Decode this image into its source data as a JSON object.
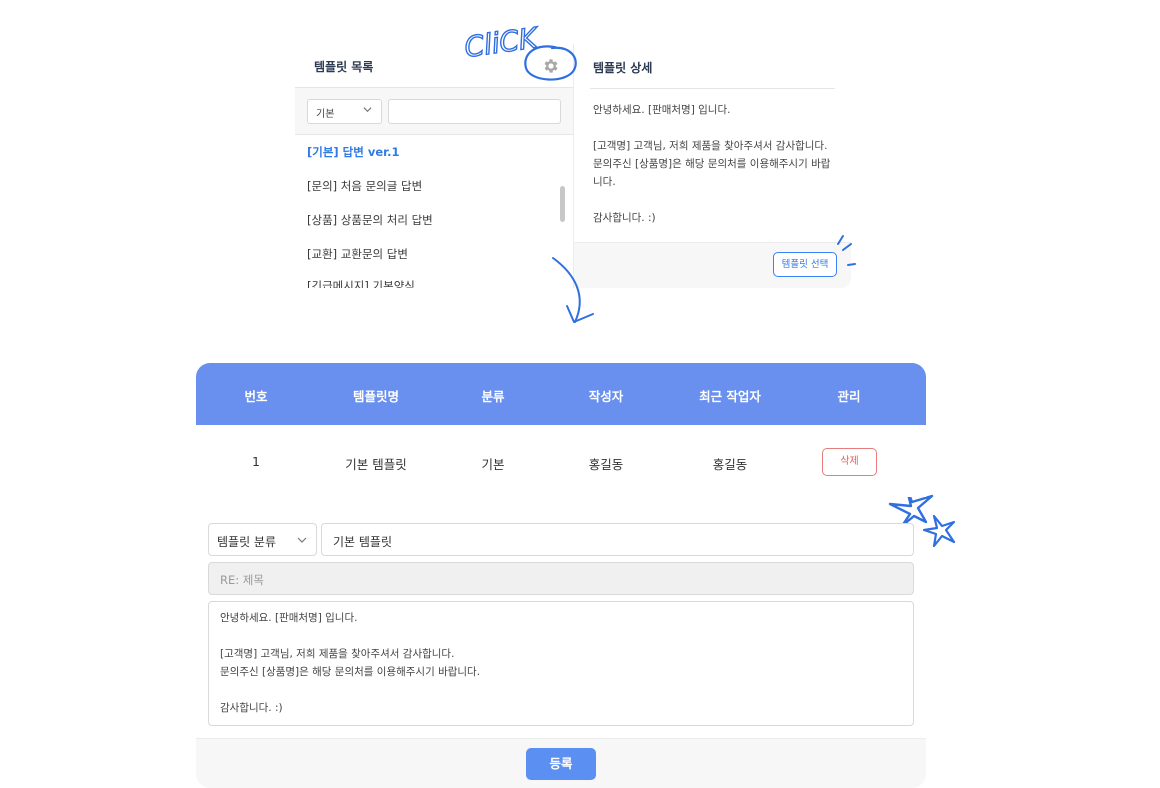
{
  "list_panel": {
    "title": "템플릿 목록",
    "category_select": "기본",
    "search_value": "",
    "items": [
      {
        "label": "[기본] 답변 ver.1",
        "active": true
      },
      {
        "label": "[문의] 처음 문의글 답변",
        "active": false
      },
      {
        "label": "[상품] 상품문의 처리 답변",
        "active": false
      },
      {
        "label": "[교환] 교환문의 답변",
        "active": false
      },
      {
        "label": "[긴급메시지] 기본양식",
        "active": false
      }
    ]
  },
  "annotation": {
    "click_label": "CliCK"
  },
  "detail_panel": {
    "title": "템플릿 상세",
    "body": "안녕하세요. [판매처명] 입니다.\n\n[고객명] 고객님, 저희 제품을 찾아주셔서 감사합니다.\n문의주신 [상품명]은 해당 문의처를 이용해주시기 바랍니다.\n\n감사합니다. :)",
    "select_button": "템플릿 선택"
  },
  "table": {
    "headers": [
      "번호",
      "템플릿명",
      "분류",
      "작성자",
      "최근 작업자",
      "관리"
    ],
    "rows": [
      {
        "no": "1",
        "name": "기본 템플릿",
        "category": "기본",
        "author": "홍길동",
        "last_editor": "홍길동",
        "delete_label": "삭제"
      }
    ]
  },
  "form": {
    "category_select": "템플릿 분류",
    "template_name": "기본 템플릿",
    "subject_placeholder": "RE: 제목",
    "body": "안녕하세요. [판매처명] 입니다.\n\n[고객명] 고객님, 저희 제품을 찾아주셔서 감사합니다.\n문의주신 [상품명]은 해당 문의처를 이용해주시기 바랍니다.\n\n감사합니다. :)",
    "register_button": "등록"
  },
  "colors": {
    "accent": "#2f7ae5",
    "table_header": "#6990ee",
    "register": "#5b8ff1",
    "delete": "#e35d5d",
    "doodle": "#2f6fe0"
  },
  "icons": [
    "gear-icon",
    "chevron-down-icon",
    "star-doodle-icon",
    "arrow-doodle-icon",
    "circle-doodle-icon"
  ]
}
